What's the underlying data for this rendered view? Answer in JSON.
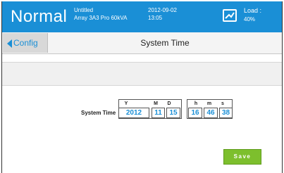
{
  "header": {
    "mode": "Normal",
    "file_name": "Untitled",
    "array_info": "Array 3A3 Pro 60kVA",
    "date": "2012-09-02",
    "time": "13:05",
    "load_label": "Load :",
    "load_value": "40%",
    "background_color": "#1a8fd6"
  },
  "navbar": {
    "back_label": "Config",
    "title": "System Time"
  },
  "system_time": {
    "row_label": "System Time",
    "headers": {
      "year": "Y",
      "month": "M",
      "day": "D",
      "hour": "h",
      "minute": "m",
      "second": "s"
    },
    "values": {
      "year": "2012",
      "month": "11",
      "day": "15",
      "hour": "16",
      "minute": "46",
      "second": "38"
    }
  },
  "actions": {
    "save_label": "Save",
    "save_color": "#7dbf2d"
  }
}
